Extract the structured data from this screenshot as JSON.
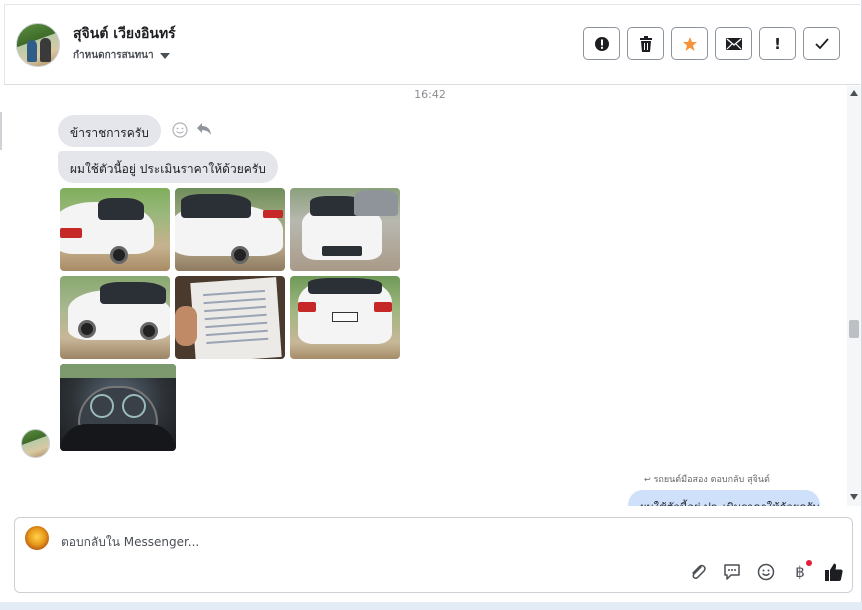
{
  "header": {
    "contact_name": "สุจินต์ เวียงอินทร์",
    "sub_label": "กำหนดการสนทนา",
    "toolbar": [
      {
        "icon": "spam-icon",
        "glyph": "!"
      },
      {
        "icon": "trash-icon",
        "glyph": "🗑"
      },
      {
        "icon": "star-icon",
        "glyph": "★"
      },
      {
        "icon": "mail-icon",
        "glyph": "✉"
      },
      {
        "icon": "important-icon",
        "glyph": "!"
      },
      {
        "icon": "check-icon",
        "glyph": "✓"
      }
    ]
  },
  "messages": {
    "timestamp": "16:42",
    "incoming": [
      {
        "text": "ข้าราชการครับ"
      },
      {
        "text": "ผมใช้ตัวนี้อยู่ ประเมินราคาให้ด้วยครับ"
      }
    ],
    "reply_note": "รถยนต์มือสอง ตอบกลับ สุจินต์",
    "outgoing": {
      "text": "ผมใช้ตัวนี้อยู่ ประเมินราคาให้ด้วยครับ"
    }
  },
  "composer": {
    "placeholder": "ตอบกลับใน Messenger..."
  },
  "colors": {
    "accent_star": "#f7923a",
    "outgoing_bubble": "#cfe0fb",
    "incoming_bubble": "#e4e6eb"
  }
}
